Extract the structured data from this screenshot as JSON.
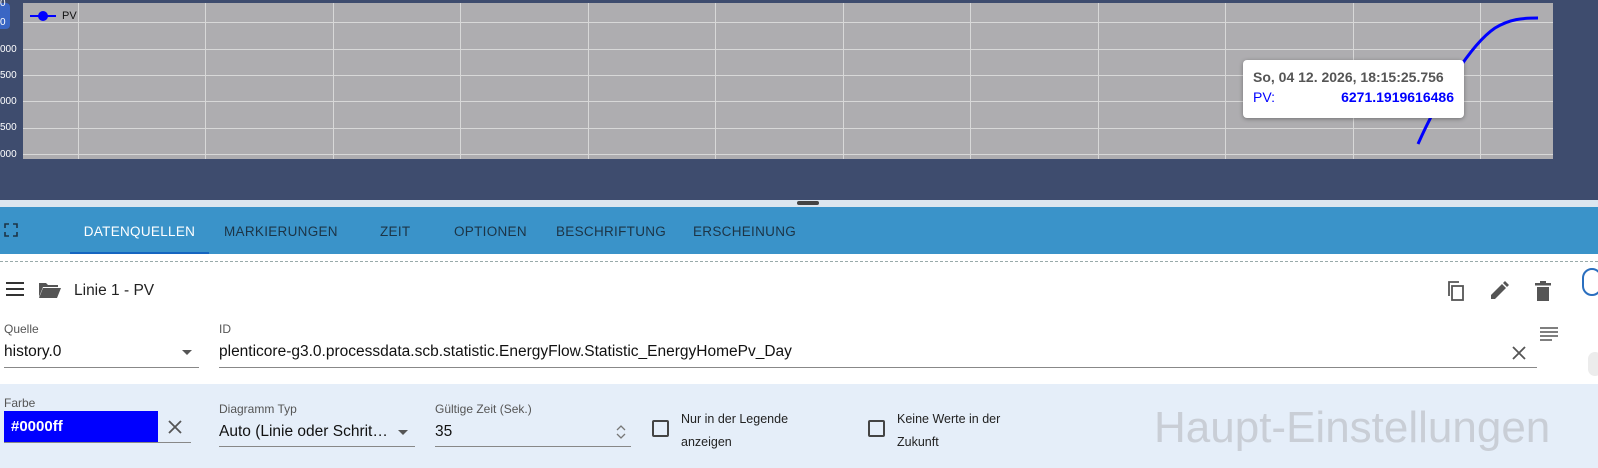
{
  "chart": {
    "legend": "PV",
    "y_tick_labels": [
      "0",
      "0",
      "000",
      "500",
      "000",
      "500",
      "000"
    ],
    "tooltip": {
      "title": "So, 04 12. 2026, 18:15:25.756",
      "series": "PV:",
      "value": "6271.1919616486"
    },
    "line_color": "#0000ff"
  },
  "tabs": [
    "DATENQUELLEN",
    "MARKIERUNGEN",
    "ZEIT",
    "OPTIONEN",
    "BESCHRIFTUNG",
    "ERSCHEINUNG"
  ],
  "active_tab": "DATENQUELLEN",
  "line": {
    "title": "Linie 1 - PV",
    "source_label": "Quelle",
    "source_value": "history.0",
    "id_label": "ID",
    "id_value": "plenticore-g3.0.processdata.scb.statistic.EnergyFlow.Statistic_EnergyHomePv_Day"
  },
  "settings": {
    "color_label": "Farbe",
    "color_value": "#0000ff",
    "chart_type_label": "Diagramm Typ",
    "chart_type_value": "Auto (Linie oder Schrit…",
    "valid_time_label": "Gültige Zeit (Sek.)",
    "valid_time_value": "35",
    "legend_only_label_1": "Nur in der Legende",
    "legend_only_label_2": "anzeigen",
    "no_future_label_1": "Keine Werte in der",
    "no_future_label_2": "Zukunft",
    "section_watermark": "Haupt-Einstellungen"
  },
  "icons": [
    "fullscreen-icon",
    "menu-icon",
    "folder-open-icon",
    "copy-icon",
    "edit-icon",
    "delete-icon",
    "clear-icon",
    "list-icon",
    "chevron-down-icon"
  ]
}
